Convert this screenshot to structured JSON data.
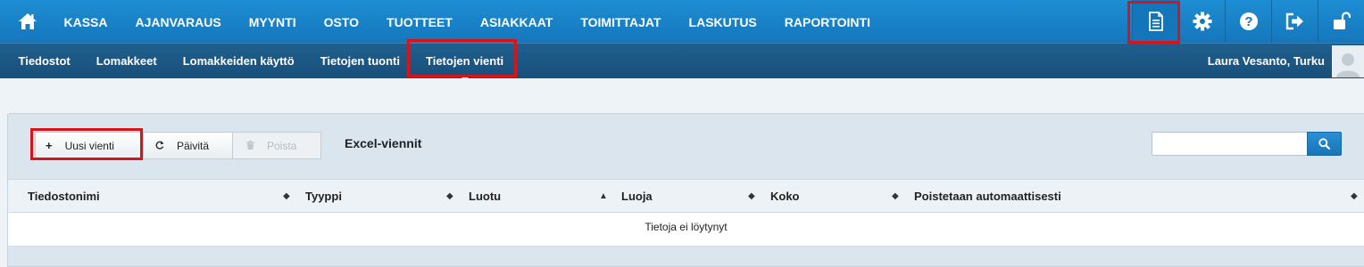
{
  "main_nav": [
    "KASSA",
    "AJANVARAUS",
    "MYYNTI",
    "OSTO",
    "TUOTTEET",
    "ASIAKKAAT",
    "TOIMITTAJAT",
    "LASKUTUS",
    "RAPORTOINTI"
  ],
  "tool_icons": [
    "document-icon",
    "gear-icon",
    "help-icon",
    "logout-icon",
    "unlock-icon"
  ],
  "sub_nav": [
    "Tiedostot",
    "Lomakkeet",
    "Lomakkeiden käyttö",
    "Tietojen tuonti",
    "Tietojen vienti"
  ],
  "sub_nav_active": "Tietojen vienti",
  "user": "Laura Vesanto, Turku",
  "toolbar": {
    "new_label": "Uusi vienti",
    "refresh_label": "Päivitä",
    "delete_label": "Poista",
    "title": "Excel-viennit"
  },
  "search": {
    "placeholder": ""
  },
  "columns": [
    "Tiedostonimi",
    "Tyyppi",
    "Luotu",
    "Luoja",
    "Koko",
    "Poistetaan automaattisesti"
  ],
  "empty_text": "Tietoja ei löytynyt",
  "colors": {
    "accent": "#1577bb",
    "subbar": "#1a5380",
    "highlight": "#d7141a"
  }
}
